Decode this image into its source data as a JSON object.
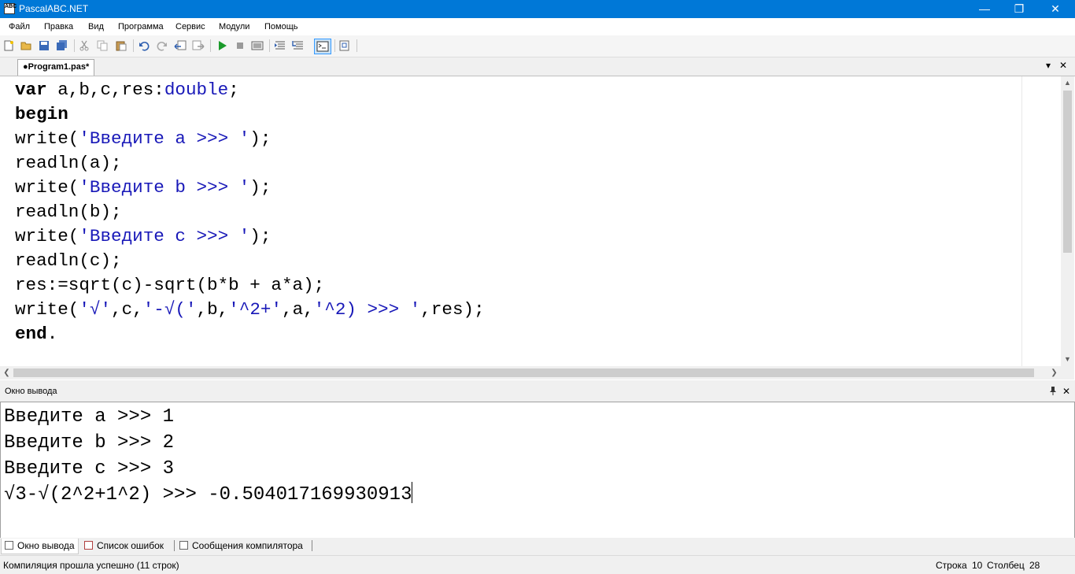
{
  "window": {
    "icon_text": "ABC",
    "title": "PascalABC.NET",
    "minimize": "—",
    "restore": "❐",
    "close": "✕"
  },
  "menu": [
    "Файл",
    "Правка",
    "Вид",
    "Программа",
    "Сервис",
    "Модули",
    "Помощь"
  ],
  "editor_tab": {
    "label": "●Program1.pas*",
    "dropdown": "▾",
    "close": "✕"
  },
  "code_lines": [
    [
      {
        "t": "var",
        "c": "kw"
      },
      {
        "t": " a,b,c,res:"
      },
      {
        "t": "double",
        "c": "typ"
      },
      {
        "t": ";"
      }
    ],
    [
      {
        "t": "begin",
        "c": "kw"
      }
    ],
    [
      {
        "t": "write("
      },
      {
        "t": "'Введите a >>> '",
        "c": "str"
      },
      {
        "t": ");"
      }
    ],
    [
      {
        "t": "readln(a);"
      }
    ],
    [
      {
        "t": "write("
      },
      {
        "t": "'Введите b >>> '",
        "c": "str"
      },
      {
        "t": ");"
      }
    ],
    [
      {
        "t": "readln(b);"
      }
    ],
    [
      {
        "t": "write("
      },
      {
        "t": "'Введите c >>> '",
        "c": "str"
      },
      {
        "t": ");"
      }
    ],
    [
      {
        "t": "readln(c);"
      }
    ],
    [
      {
        "t": "res:=sqrt(c)-sqrt(b*b + a*a);"
      }
    ],
    [
      {
        "t": "write("
      },
      {
        "t": "'√'",
        "c": "str"
      },
      {
        "t": ",c,"
      },
      {
        "t": "'-√('",
        "c": "str"
      },
      {
        "t": ",b,"
      },
      {
        "t": "'^2+'",
        "c": "str"
      },
      {
        "t": ",a,"
      },
      {
        "t": "'^2) >>> '",
        "c": "str"
      },
      {
        "t": ",res);"
      }
    ],
    [
      {
        "t": "end",
        "c": "kw"
      },
      {
        "t": "."
      }
    ]
  ],
  "output_panel": {
    "title": "Окно вывода",
    "pin": "📌",
    "close": "✕",
    "lines": [
      "Введите a >>> 1",
      "Введите b >>> 2",
      "Введите c >>> 3",
      "√3-√(2^2+1^2) >>> -0.504017169930913"
    ]
  },
  "bottom_tabs": [
    "Окно вывода",
    "Список ошибок",
    "Сообщения компилятора"
  ],
  "status": {
    "message": "Компиляция прошла успешно (11 строк)",
    "row_label": "Строка",
    "row_value": "10",
    "col_label": "Столбец",
    "col_value": "28"
  },
  "colors": {
    "titlebar": "#0078d7",
    "string": "#1818b8"
  }
}
